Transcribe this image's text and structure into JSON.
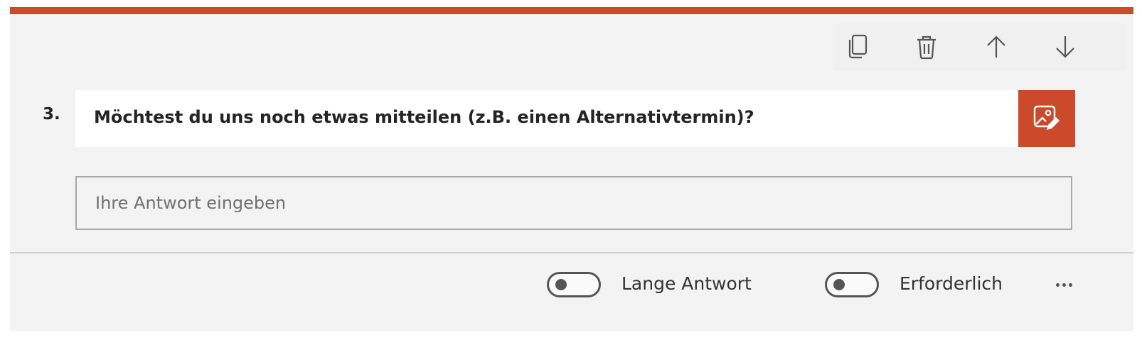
{
  "colors": {
    "accent": "#cc4a2b",
    "card_background": "#f3f3f3",
    "icon_color": "#555555"
  },
  "toolbar": {
    "icons": [
      "copy-icon",
      "trash-icon",
      "arrow-up-icon",
      "arrow-down-icon"
    ]
  },
  "question": {
    "number": "3.",
    "title": "Möchtest du uns noch etwas mitteilen (z.B. einen Alternativtermin)?",
    "image_button_icon": "image-edit-icon"
  },
  "answer": {
    "placeholder": "Ihre Antwort eingeben"
  },
  "footer": {
    "long_answer_label": "Lange Antwort",
    "long_answer_enabled": false,
    "required_label": "Erforderlich",
    "required_enabled": false,
    "more_icon": "more-options-icon"
  }
}
